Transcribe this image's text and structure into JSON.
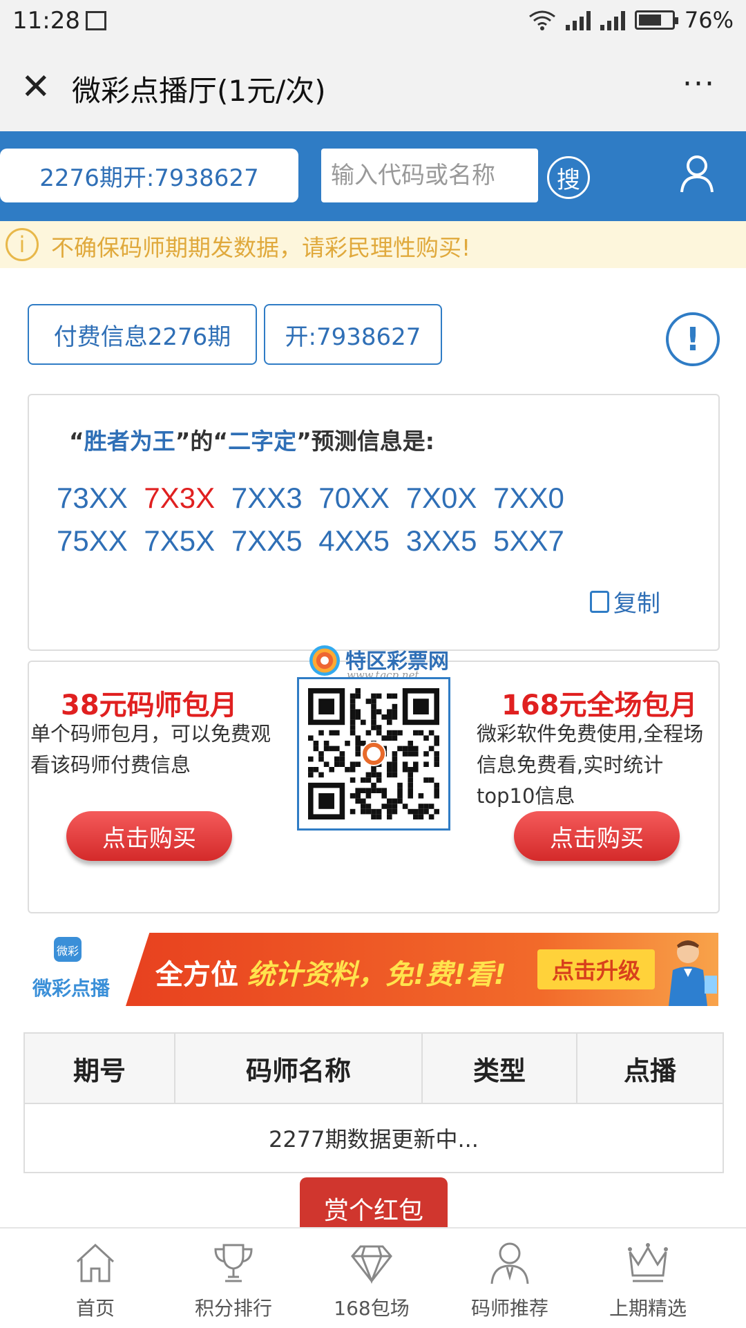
{
  "status": {
    "time": "11:28",
    "battery": "76%"
  },
  "titlebar": {
    "title": "微彩点播厅(1元/次)",
    "more": "···"
  },
  "header": {
    "period": "2276期开:7938627",
    "search_placeholder": "输入代码或名称",
    "search_label": "搜"
  },
  "warning": "不确保码师期期发数据，请彩民理性购买!",
  "info": {
    "paid": "付费信息2276期",
    "open": "开:7938627",
    "icon": "!"
  },
  "prediction": {
    "q1": "“",
    "master": "胜者为王",
    "q2": "”的“",
    "type": "二字定",
    "q3": "”预测信息是:",
    "codes": [
      "73XX",
      "7X3X",
      "7XX3",
      "70XX",
      "7X0X",
      "7XX0",
      "75XX",
      "7X5X",
      "7XX5",
      "4XX5",
      "3XX5",
      "5XX7"
    ],
    "highlight_index": 1,
    "copy": "复制"
  },
  "promo": {
    "left": {
      "title": "38元码师包月",
      "desc": "单个码师包月，可以免费观看该码师付费信息",
      "button": "点击购买"
    },
    "right": {
      "title": "168元全场包月",
      "desc": "微彩软件免费使用,全程场信息免费看,实时统计top10信息",
      "button": "点击购买"
    },
    "qr_brand": "特区彩票网",
    "qr_url": "www.tqcp.net"
  },
  "banner": {
    "logo_small": "微彩",
    "logo_text": "微彩点播",
    "text1": "全方位",
    "text2": "统计资料，免!费!看!",
    "button": "点击升级"
  },
  "table": {
    "headers": [
      "期号",
      "码师名称",
      "类型",
      "点播"
    ],
    "status": "2277期数据更新中..."
  },
  "reward_button": "赏个红包",
  "nav": [
    {
      "label": "首页",
      "icon": "home-icon"
    },
    {
      "label": "积分排行",
      "icon": "trophy-icon"
    },
    {
      "label": "168包场",
      "icon": "diamond-icon"
    },
    {
      "label": "码师推荐",
      "icon": "person-icon"
    },
    {
      "label": "上期精选",
      "icon": "crown-icon"
    }
  ],
  "colors": {
    "primary": "#2f7cc5",
    "red": "#e02020",
    "warning": "#e0a93c"
  }
}
